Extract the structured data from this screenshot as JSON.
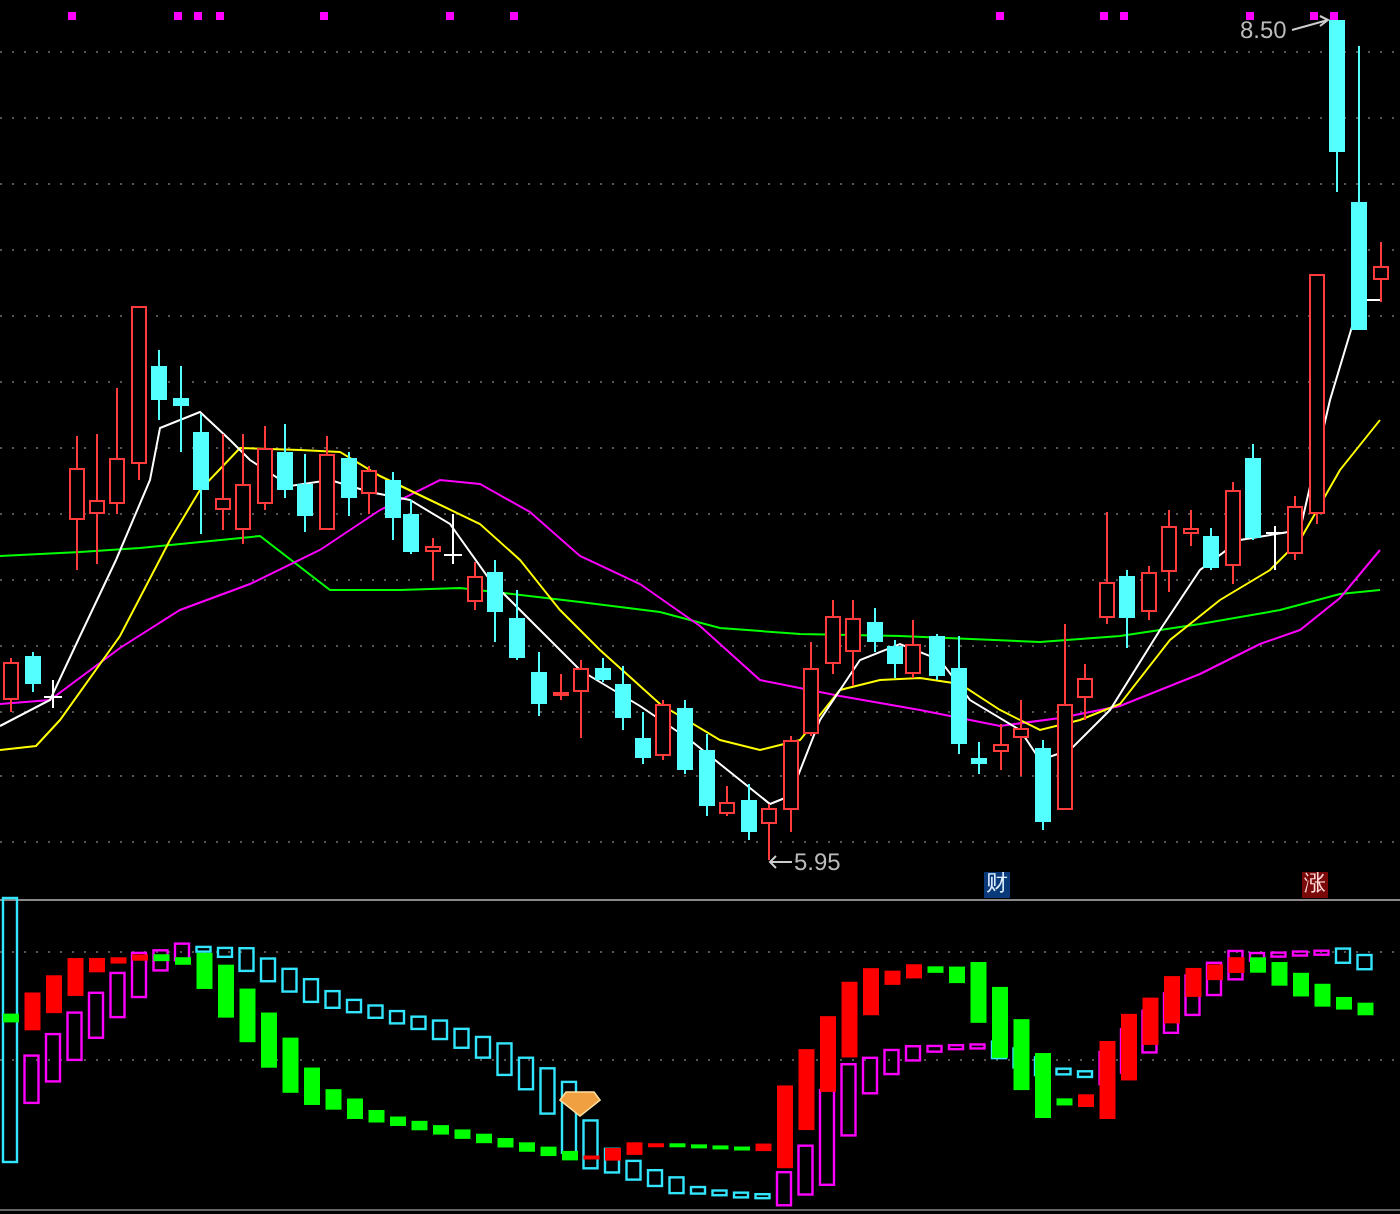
{
  "price_panel": {
    "high_label": "8.50",
    "low_label": "5.95",
    "badges": [
      {
        "text": "财",
        "kind": "finance"
      },
      {
        "text": "涨",
        "kind": "limit_up"
      }
    ]
  }
}
